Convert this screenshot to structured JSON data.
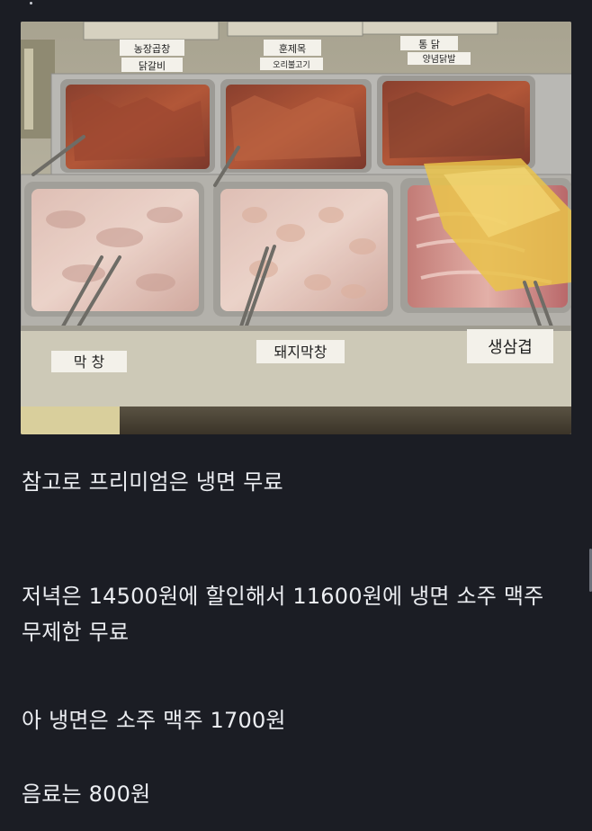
{
  "photo": {
    "labels": {
      "top_left": "농장곱창",
      "top_left_2": "닭갈비",
      "top_mid": "훈제목",
      "top_mid_2": "오리불고기",
      "top_right": "통 닭",
      "top_right_2": "양념닭발",
      "bottom_left": "막 창",
      "bottom_mid": "돼지막창",
      "bottom_right": "생삼겹"
    }
  },
  "post": {
    "line1": "참고로 프리미엄은 냉면 무료",
    "line2": "저녁은 14500원에 할인해서 11600원에 냉면 소주 맥주",
    "line3": "무제한 무료",
    "line4": "아 냉면은 소주 맥주 1700원",
    "line5": "음료는 800원"
  },
  "colors": {
    "background": "#1b1d24",
    "text": "#eceef2"
  }
}
